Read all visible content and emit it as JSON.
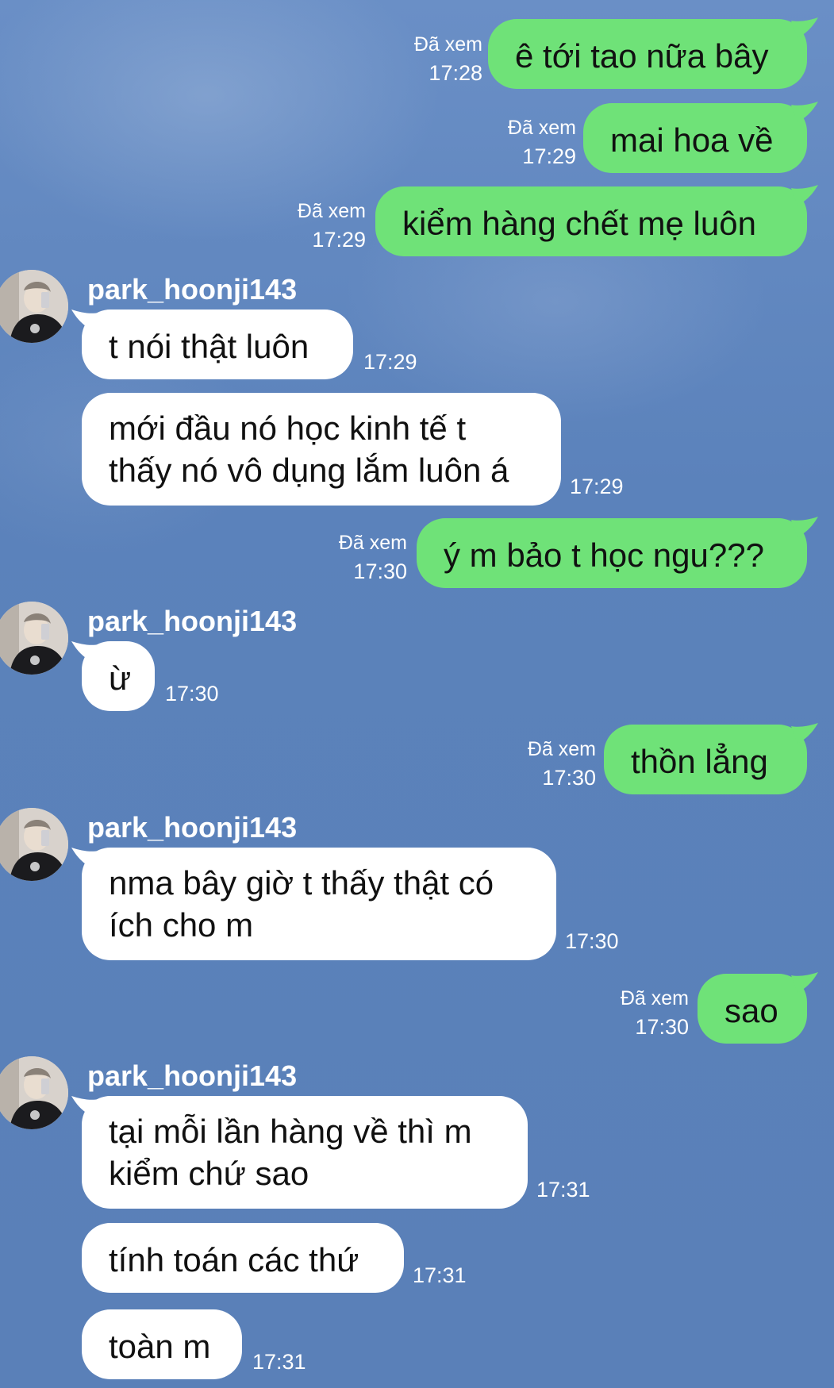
{
  "contact": {
    "username": "park_hoonji143",
    "avatar_icon": "avatar-photo"
  },
  "colors": {
    "outgoing_bubble": "#6fe278",
    "incoming_bubble": "#ffffff",
    "background": "#5b81b8"
  },
  "messages": [
    {
      "dir": "out",
      "text": "ê tới tao nữa bây",
      "seen": "Đã xem",
      "time": "17:28"
    },
    {
      "dir": "out",
      "text": "mai hoa về",
      "seen": "Đã xem",
      "time": "17:29"
    },
    {
      "dir": "out",
      "text": "kiểm hàng chết mẹ luôn",
      "seen": "Đã xem",
      "time": "17:29"
    },
    {
      "dir": "in",
      "sender": "park_hoonji143",
      "text": "t nói thật luôn",
      "time": "17:29"
    },
    {
      "dir": "in",
      "text": "mới đầu nó học kinh tế t thấy nó vô dụng lắm luôn á",
      "time": "17:29"
    },
    {
      "dir": "out",
      "text": "ý m bảo t học ngu???",
      "seen": "Đã xem",
      "time": "17:30"
    },
    {
      "dir": "in",
      "sender": "park_hoonji143",
      "text": "ừ",
      "time": "17:30"
    },
    {
      "dir": "out",
      "text": "thồn lẳng",
      "seen": "Đã xem",
      "time": "17:30"
    },
    {
      "dir": "in",
      "sender": "park_hoonji143",
      "text": "nma bây giờ t thấy thật có ích cho m",
      "time": "17:30"
    },
    {
      "dir": "out",
      "text": "sao",
      "seen": "Đã xem",
      "time": "17:30"
    },
    {
      "dir": "in",
      "sender": "park_hoonji143",
      "text": "tại mỗi lần hàng về thì m kiểm chứ sao",
      "time": "17:31"
    },
    {
      "dir": "in",
      "text": "tính toán các thứ",
      "time": "17:31"
    },
    {
      "dir": "in",
      "text": "toàn m",
      "time": "17:31"
    }
  ]
}
